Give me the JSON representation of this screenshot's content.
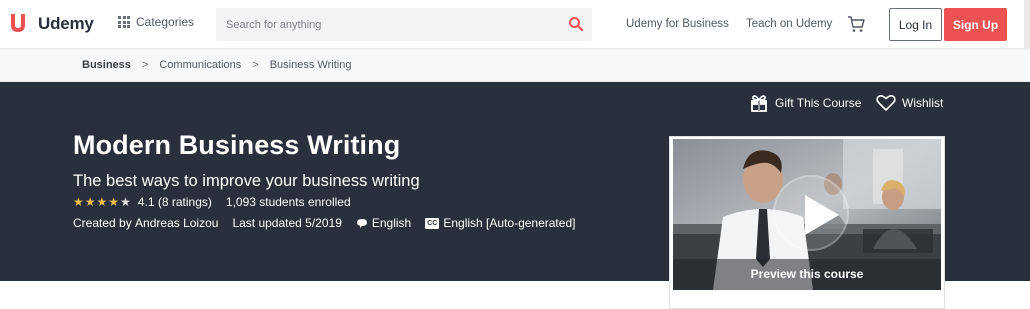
{
  "header": {
    "logo_text": "Udemy",
    "categories_label": "Categories",
    "search_placeholder": "Search for anything",
    "business_link": "Udemy for Business",
    "teach_link": "Teach on Udemy",
    "login_label": "Log In",
    "signup_label": "Sign Up",
    "brand_color": "#ec5252"
  },
  "breadcrumb": [
    "Business",
    "Communications",
    "Business Writing"
  ],
  "breadcrumb_separator": ">",
  "hero": {
    "gift_label": "Gift This Course",
    "wishlist_label": "Wishlist",
    "title": "Modern Business Writing",
    "subtitle": "The best ways to improve your business writing",
    "rating_value": "4.1",
    "rating_count": "(8 ratings)",
    "stars": 4.1,
    "enrolled": "1,093 students enrolled",
    "created_by_label": "Created by",
    "instructor": "Andreas Loizou",
    "last_updated": "Last updated 5/2019",
    "language": "English",
    "captions_icon_text": "CC",
    "captions": "English [Auto-generated]",
    "background_color": "#29303b"
  },
  "preview": {
    "label": "Preview this course"
  }
}
